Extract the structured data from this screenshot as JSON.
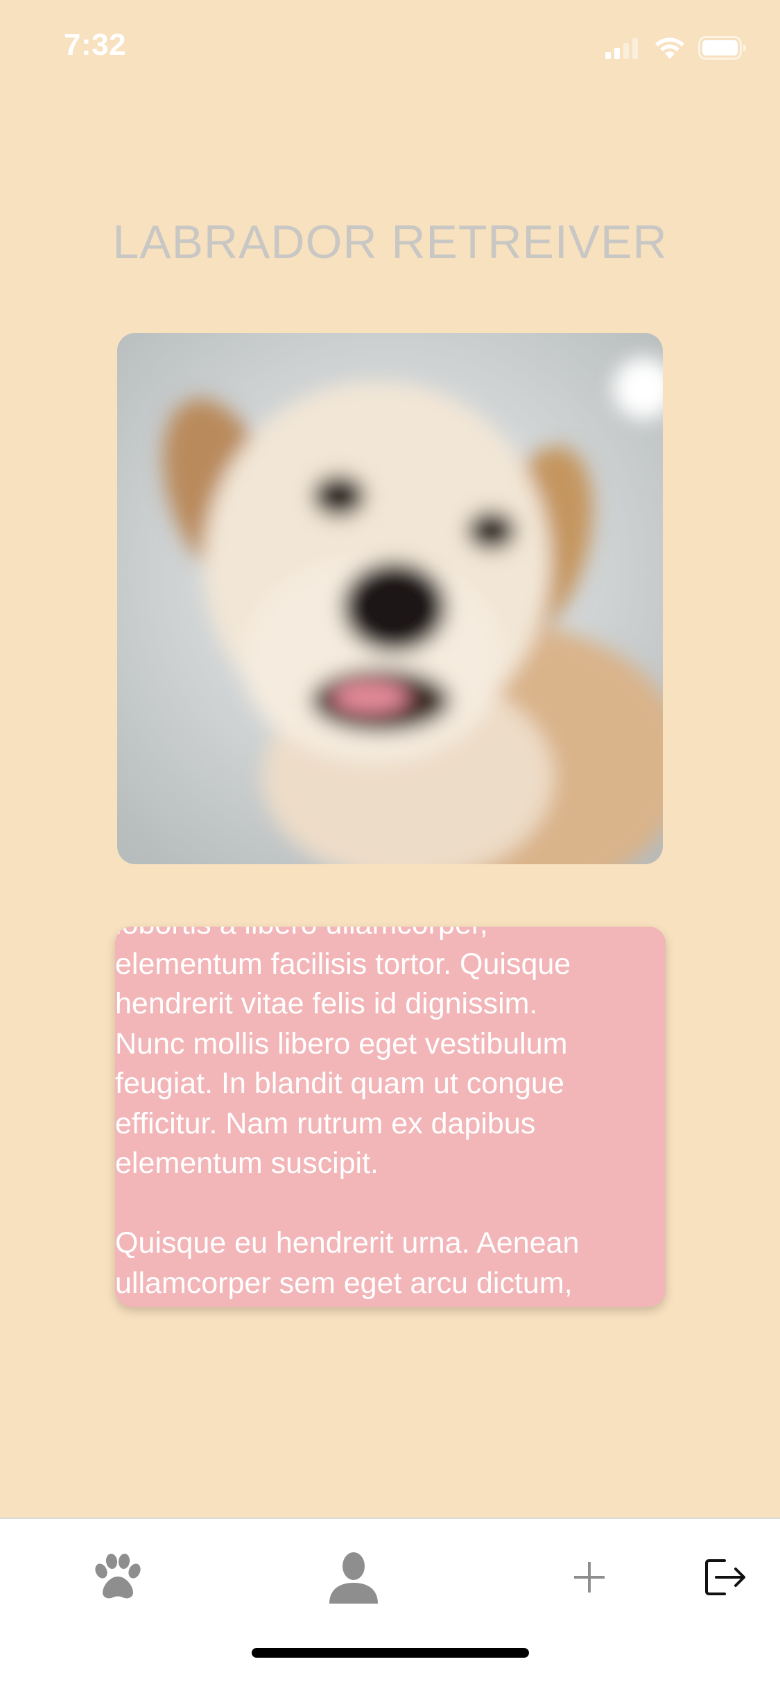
{
  "status_bar": {
    "time": "7:32",
    "icons": [
      "cellular-signal-icon",
      "wifi-icon",
      "battery-icon"
    ]
  },
  "header": {
    "title": "LABRADOR RETREIVER"
  },
  "photo": {
    "subject": "labrador-dog-photo"
  },
  "description": {
    "text": "lobortis a libero ullamcorper,\nelementum facilisis tortor. Quisque\nhendrerit vitae felis id dignissim.\nNunc mollis libero eget vestibulum\nfeugiat. In blandit quam ut congue\nefficitur. Nam rutrum ex dapibus\nelementum suscipit.\n\nQuisque eu hendrerit urna. Aenean\nullamcorper sem eget arcu dictum,\ndapibus ipsum dictum, fermentum"
  },
  "tab_bar": {
    "items": [
      {
        "icon": "paw-icon"
      },
      {
        "icon": "profile-icon"
      },
      {
        "icon": "plus-icon"
      },
      {
        "icon": "logout-icon"
      }
    ]
  },
  "colors": {
    "background": "#f8e1bf",
    "card": "#f2b5b8",
    "title": "#c8c7c4",
    "tab_icon": "#8e8e8e"
  }
}
